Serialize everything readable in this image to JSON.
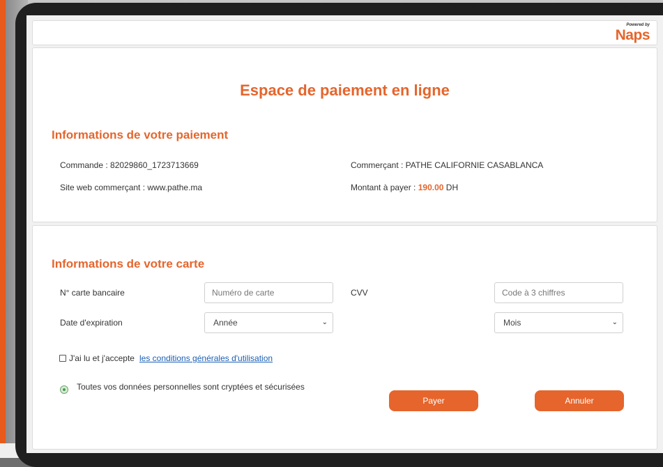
{
  "brand": {
    "powered_by": "Powered by",
    "logo_text": "Naps",
    "accent_color": "#e5652c"
  },
  "page": {
    "title": "Espace de paiement en ligne"
  },
  "payment_info": {
    "section_title": "Informations de votre paiement",
    "order": "Commande : 82029860_1723713669",
    "website": "Site web commerçant : www.pathe.ma",
    "merchant": "Commerçant : PATHE CALIFORNIE CASABLANCA",
    "amount_label": "Montant à payer : ",
    "amount_value": "190.00",
    "currency": " DH"
  },
  "card_info": {
    "section_title": "Informations de votre carte",
    "card_number_label": "N° carte bancaire",
    "card_number_placeholder": "Numéro de carte",
    "cvv_label": "CVV",
    "cvv_placeholder": "Code à 3 chiffres",
    "expiry_label": "Date d'expiration",
    "year_select": "Année",
    "month_select": "Mois",
    "terms_text": "J'ai lu et j'accepte",
    "terms_link": "les conditions générales d'utilisation",
    "security_note": "Toutes vos données personnelles sont cryptées et sécurisées",
    "pay_button": "Payer",
    "cancel_button": "Annuler"
  }
}
